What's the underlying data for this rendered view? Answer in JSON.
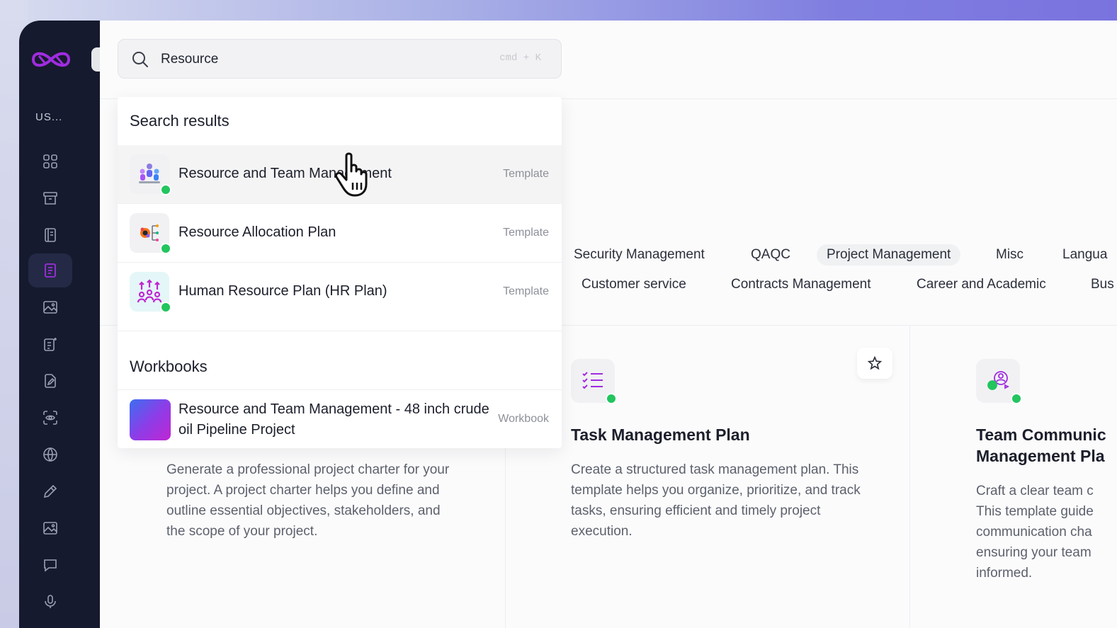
{
  "app": {
    "workspace_label": "US...",
    "accent": "#a02ce0",
    "sidebar_bg": "#161a2e"
  },
  "search": {
    "value": "Resource",
    "shortcut": "cmd + K"
  },
  "dropdown": {
    "results_heading": "Search results",
    "results": [
      {
        "title": "Resource and Team Management",
        "type": "Template",
        "icon": "team-people-icon"
      },
      {
        "title": "Resource Allocation Plan",
        "type": "Template",
        "icon": "allocation-gear-icon"
      },
      {
        "title": "Human Resource Plan (HR Plan)",
        "type": "Template",
        "icon": "hr-growth-icon"
      }
    ],
    "workbooks_heading": "Workbooks",
    "workbooks": [
      {
        "title": "Resource and Team Management - 48 inch crude oil Pipeline Project",
        "type": "Workbook"
      }
    ]
  },
  "categories": {
    "row1": [
      "Security Management",
      "QAQC",
      "Project Management",
      "Misc",
      "Langua"
    ],
    "row2": [
      "Customer service",
      "Contracts Management",
      "Career and Academic",
      "Bus"
    ],
    "active": "Project Management"
  },
  "cards": [
    {
      "title": "",
      "description": "Generate a professional project charter for your project. A project charter helps you define and outline essential objectives, stakeholders, and the scope of your project."
    },
    {
      "title": "Task Management Plan",
      "description": "Create a structured task management plan. This template helps you organize, prioritize, and track tasks, ensuring efficient and timely project execution."
    },
    {
      "title": "Team Communic Management Pla",
      "description": "Craft a clear team c This template guide communication cha ensuring your team informed."
    }
  ]
}
